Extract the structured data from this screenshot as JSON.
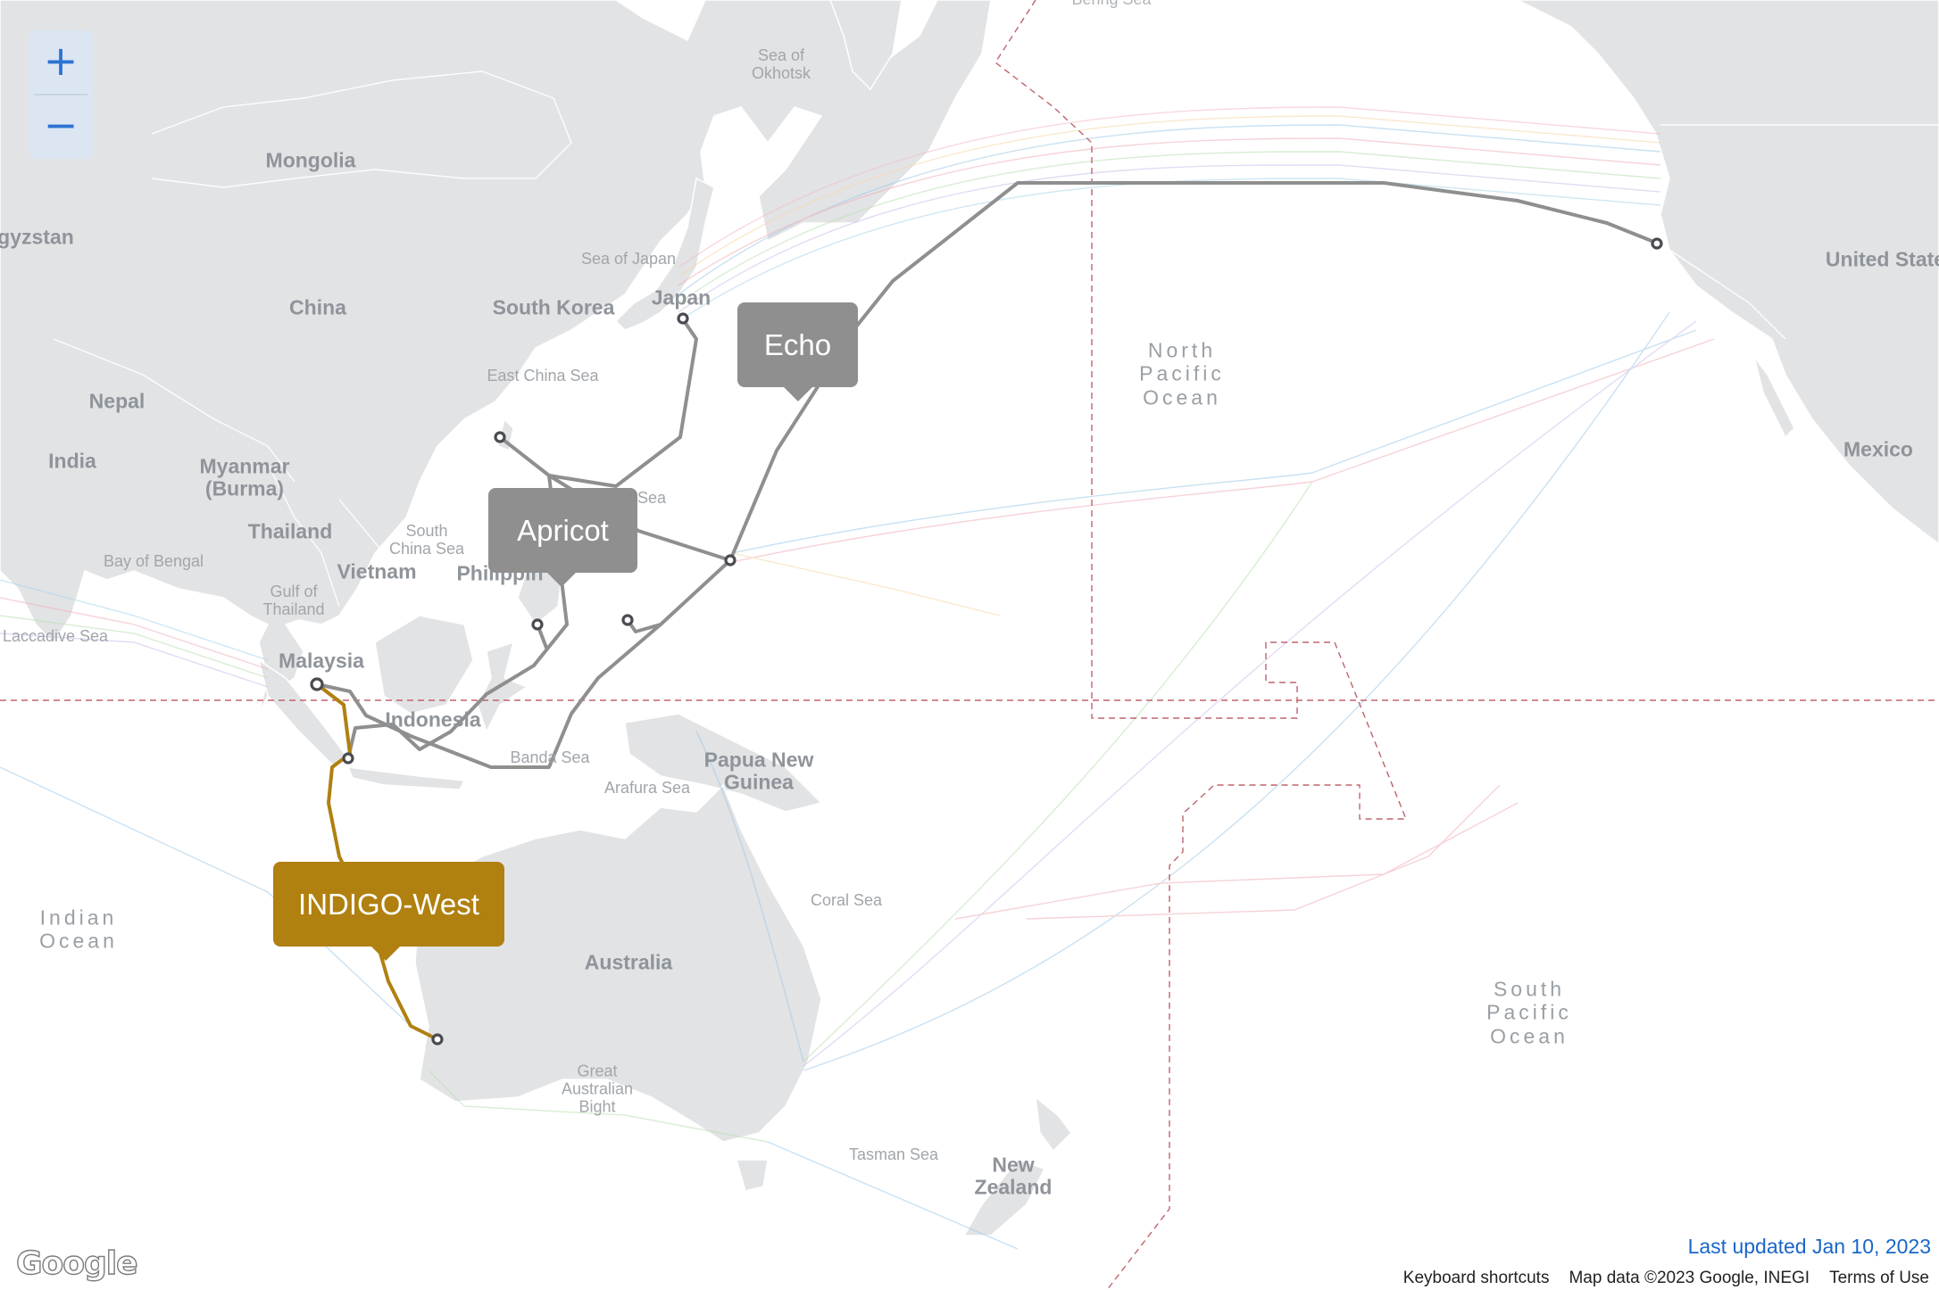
{
  "map": {
    "zoom_in_label": "+",
    "zoom_out_label": "−",
    "last_updated": "Last updated Jan 10, 2023",
    "google_logo": "Google",
    "footer": {
      "keyboard_shortcuts": "Keyboard shortcuts",
      "map_data": "Map data ©2023 Google, INEGI",
      "terms": "Terms of Use"
    },
    "labels": {
      "mongolia": "Mongolia",
      "kyrgyzstan": "gyzstan",
      "china": "China",
      "south_korea": "South Korea",
      "japan": "Japan",
      "nepal": "Nepal",
      "india": "India",
      "myanmar": "Myanmar\n(Burma)",
      "thailand": "Thailand",
      "vietnam": "Vietnam",
      "philippines": "Philippin",
      "malaysia": "Malaysia",
      "indonesia": "Indonesia",
      "papua_new_guinea": "Papua New\nGuinea",
      "australia": "Australia",
      "new_zealand": "New\nZealand",
      "united_states": "United State",
      "mexico": "Mexico",
      "sea_of_okhotsk": "Sea of\nOkhotsk",
      "sea_of_japan": "Sea of Japan",
      "east_china_sea": "East China Sea",
      "philippine_sea_fragment": "Sea",
      "south_china_sea": "South\nChina Sea",
      "bay_of_bengal": "Bay of Bengal",
      "gulf_of_thailand": "Gulf of\nThailand",
      "laccadive_sea": "Laccadive Sea",
      "banda_sea": "Banda Sea",
      "arafura_sea": "Arafura Sea",
      "coral_sea": "Coral Sea",
      "great_australian_bight": "Great\nAustralian\nBight",
      "tasman_sea": "Tasman Sea",
      "north_pacific_ocean": "North\nPacific\nOcean",
      "south_pacific_ocean": "South\nPacific\nOcean",
      "indian_ocean": "Indian\nOcean",
      "bering_sea_fragment": "Bering Sea"
    },
    "cables": [
      {
        "name": "Echo",
        "color": "#8f8f8f",
        "highlighted": false
      },
      {
        "name": "Apricot",
        "color": "#8f8f8f",
        "highlighted": false
      },
      {
        "name": "INDIGO-West",
        "color": "#b08010",
        "highlighted": true
      }
    ],
    "colors": {
      "land": "#e2e3e5",
      "water": "#ffffff",
      "boundary_dashed": "#c0646c",
      "zoom_bg": "#dbe6f2",
      "zoom_icon": "#2d73d2",
      "link": "#1a66c8"
    }
  }
}
